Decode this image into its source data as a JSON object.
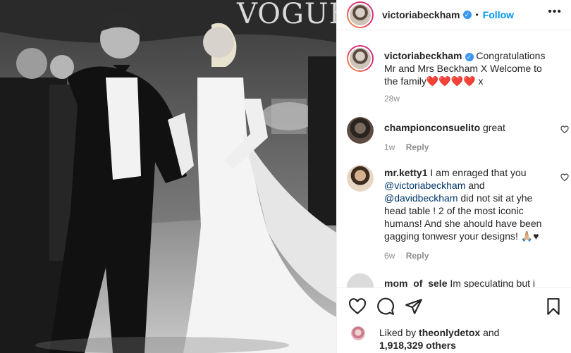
{
  "photo": {
    "watermark": "VOGUE"
  },
  "header": {
    "username": "victoriabeckham",
    "separator": "•",
    "follow_label": "Follow",
    "more_icon": "more-options-icon"
  },
  "caption": {
    "username": "victoriabeckham",
    "text": "Congratulations Mr and Mrs Beckham X Welcome to the family",
    "hearts": "❤️❤️❤️❤️",
    "suffix": "x",
    "age": "28w"
  },
  "comments": [
    {
      "username": "championconsuelito",
      "text": "great",
      "age": "1w",
      "reply_label": "Reply"
    },
    {
      "username": "mr.ketty1",
      "text_1": "I am enraged that you",
      "mention_1": "@victoriabeckham",
      "text_2": "and",
      "mention_2": "@davidbeckham",
      "text_3": "did not sit at yhe head table ! 2 of the most iconic humans! And she ahould have been gagging tonwesr your designs!",
      "emoji": "🙏🏼♥",
      "age": "6w",
      "reply_label": "Reply"
    },
    {
      "username": "mom_of_sele",
      "text": "Im speculating but i"
    }
  ],
  "actions": {
    "like_icon": "heart-icon",
    "comment_icon": "comment-icon",
    "share_icon": "send-icon",
    "save_icon": "bookmark-icon"
  },
  "likes": {
    "prefix": "Liked by",
    "liker": "theonlydetox",
    "middle": "and",
    "count": "1,918,329 others"
  },
  "colors": {
    "follow": "#0095f6",
    "verified": "#3897f0",
    "heart": "#ed4956",
    "secondary_text": "#8e8e8e"
  }
}
